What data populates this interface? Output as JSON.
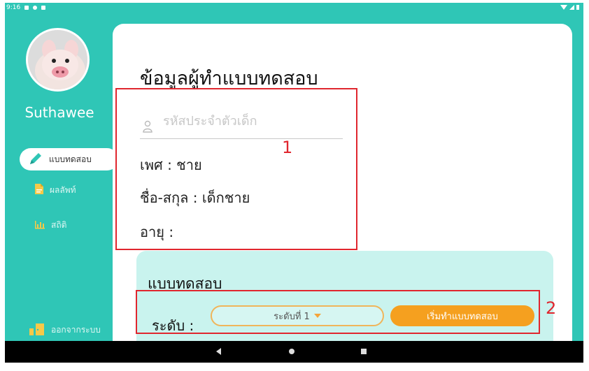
{
  "status_bar": {
    "time": "9:16",
    "icons": [
      "notification-icon",
      "sync-icon",
      "storage-icon",
      "wifi-icon",
      "signal-icon",
      "battery-icon"
    ]
  },
  "sidebar": {
    "username": "Suthawee",
    "items": [
      {
        "label": "แบบทดสอบ",
        "icon": "pencil-icon",
        "active": true
      },
      {
        "label": "ผลลัพท์",
        "icon": "document-icon",
        "active": false
      },
      {
        "label": "สถิติ",
        "icon": "bar-chart-icon",
        "active": false
      }
    ],
    "logout": {
      "label": "ออกจากระบบ",
      "icon": "door-exit-icon"
    }
  },
  "main": {
    "title": "ข้อมูลผู้ทำแบบทดสอบ",
    "id_field": {
      "placeholder": "รหัสประจำตัวเด็ก",
      "value": ""
    },
    "gender": "เพศ : ชาย",
    "full_name": "ชื่อ-สกุล : เด็กชาย",
    "age": "อายุ :",
    "test_section": {
      "title": "แบบทดสอบ",
      "level_label": "ระดับ :",
      "level_selected": "ระดับที่ 1",
      "start_button": "เริ่มทำแบบทดสอบ"
    }
  },
  "annotations": {
    "label_1": "1",
    "label_2": "2",
    "color": "#e0262e"
  },
  "colors": {
    "teal": "#2fc6b6",
    "orange": "#f5a01f",
    "panel": "#c9f3ee"
  }
}
